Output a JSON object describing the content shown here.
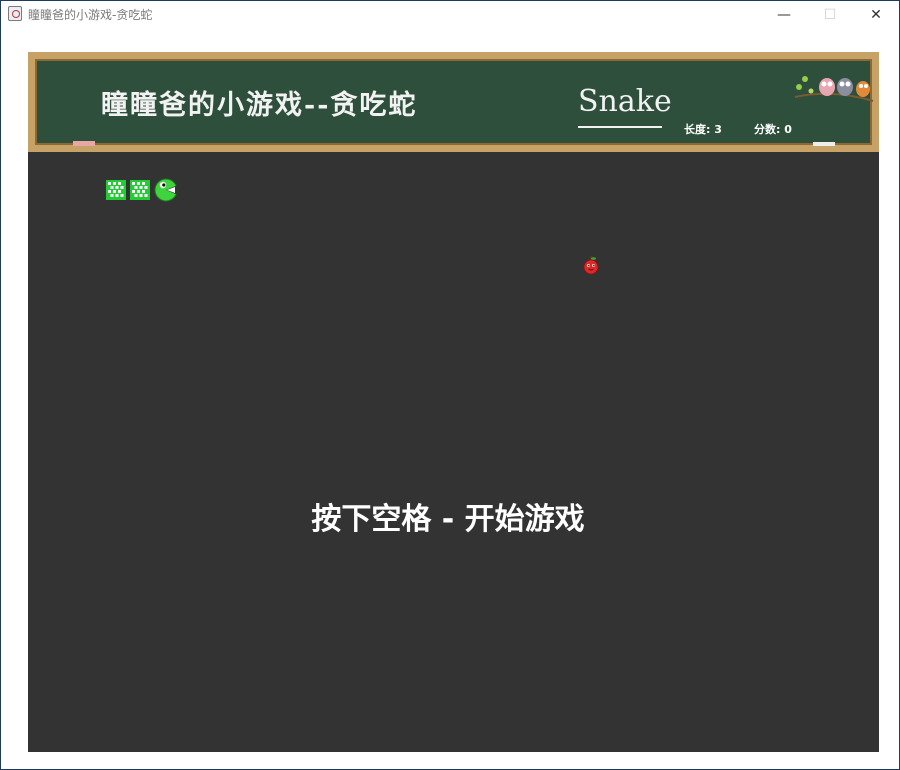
{
  "window": {
    "title": "瞳瞳爸的小游戏-贪吃蛇",
    "icon": "java-cup-icon",
    "controls": {
      "minimize": "—",
      "maximize": "☐",
      "close": "✕"
    }
  },
  "board": {
    "title": "瞳瞳爸的小游戏--贪吃蛇",
    "subtitle": "Snake",
    "length_label": "长度: 3",
    "score_label": "分数: 0",
    "decoration": "owls-on-branch-icon"
  },
  "game": {
    "snake_length": 3,
    "score": 0,
    "prompt": "按下空格 - 开始游戏",
    "colors": {
      "background": "#333333",
      "board": "#2d4f3c",
      "board_frame": "#c7a267",
      "snake_body": "#22cc33",
      "snake_head": "#3ed43e",
      "apple": "#e02828"
    }
  }
}
